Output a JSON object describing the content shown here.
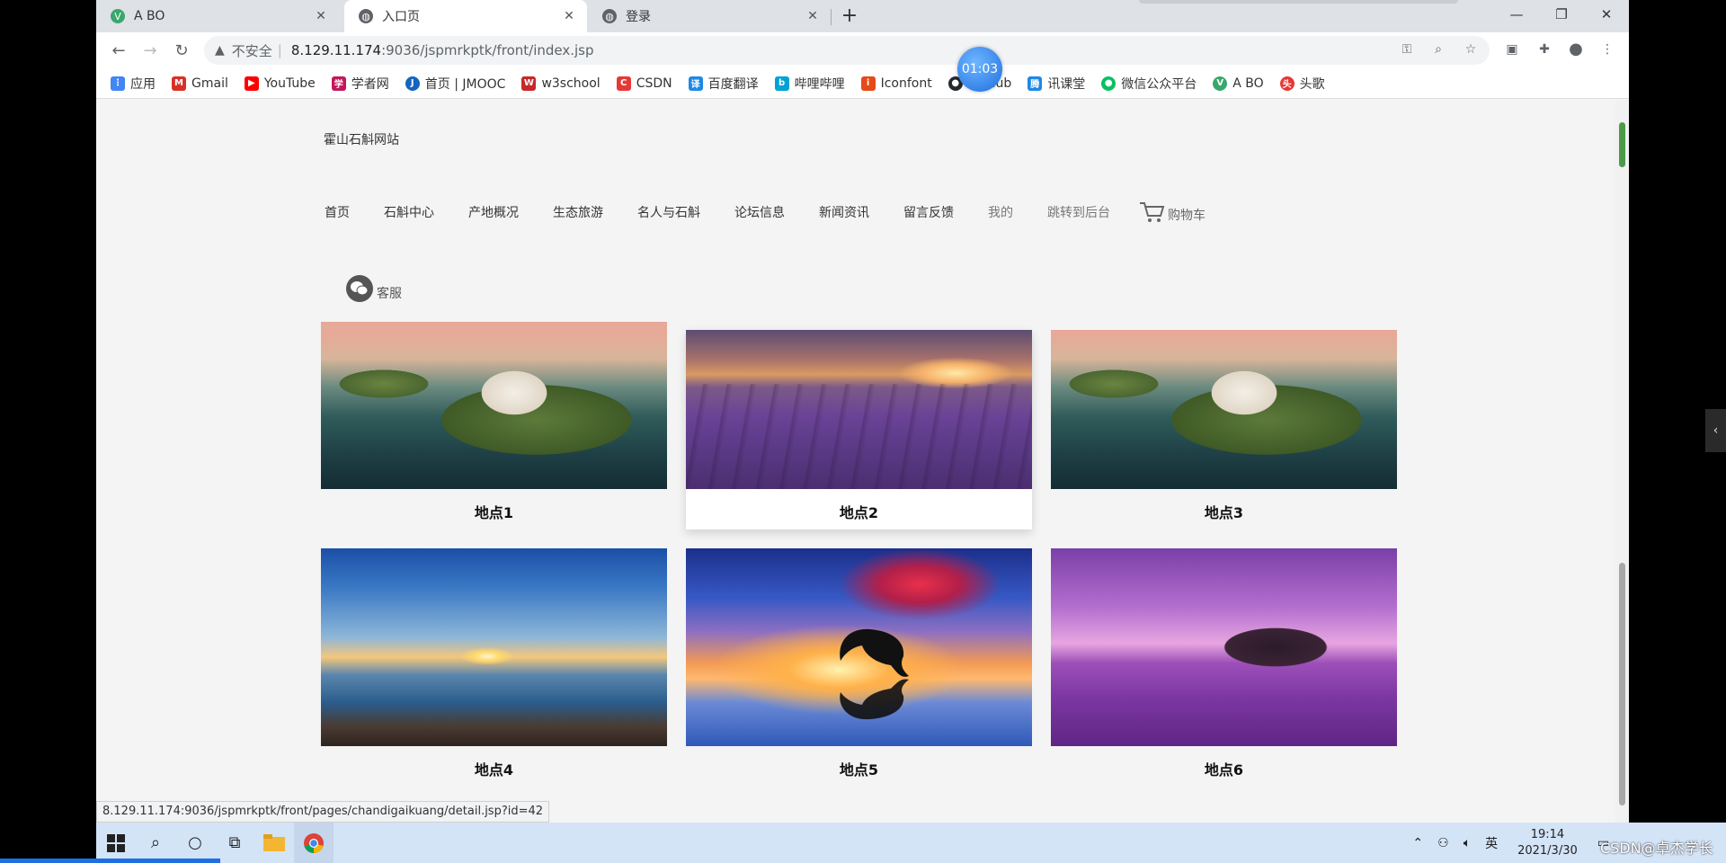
{
  "tabs": [
    {
      "title": "A BO",
      "favicon_color": "#3aa76d"
    },
    {
      "title": "入口页",
      "favicon_color": "#5f6368"
    },
    {
      "title": "登录",
      "favicon_color": "#5f6368"
    }
  ],
  "toolbar": {
    "security": "不安全",
    "url_host": "8.129.11.174",
    "url_path": ":9036/jspmrkptk/front/index.jsp"
  },
  "timer": "01:03",
  "bookmarks": [
    {
      "label": "应用",
      "icon": "apps-icon",
      "color": "#4285f4"
    },
    {
      "label": "Gmail",
      "icon": "gmail-icon",
      "color": "#d93025"
    },
    {
      "label": "YouTube",
      "icon": "youtube-icon",
      "color": "#ff0000"
    },
    {
      "label": "学者网",
      "icon": "scholar-icon",
      "color": "#c2185b"
    },
    {
      "label": "首页 | JMOOC",
      "icon": "jmooc-icon",
      "color": "#1565c0"
    },
    {
      "label": "w3school",
      "icon": "w3school-icon",
      "color": "#c62828"
    },
    {
      "label": "CSDN",
      "icon": "csdn-icon",
      "color": "#e53935"
    },
    {
      "label": "百度翻译",
      "icon": "baidu-translate-icon",
      "color": "#1e88e5"
    },
    {
      "label": "哔哩哔哩",
      "icon": "bilibili-icon",
      "color": "#00a1d6"
    },
    {
      "label": "Iconfont",
      "icon": "iconfont-icon",
      "color": "#e64a19"
    },
    {
      "label": "GitHub",
      "icon": "github-icon",
      "color": "#24292e"
    },
    {
      "label": "讯课堂",
      "icon": "tencent-class-icon",
      "color": "#1e88e5"
    },
    {
      "label": "微信公众平台",
      "icon": "wechat-icon",
      "color": "#07c160"
    },
    {
      "label": "A BO",
      "icon": "abo-icon",
      "color": "#3aa76d"
    },
    {
      "label": "头歌",
      "icon": "touge-icon",
      "color": "#e53935"
    }
  ],
  "site": {
    "title": "霍山石斛网站",
    "nav": [
      "首页",
      "石斛中心",
      "产地概况",
      "生态旅游",
      "名人与石斛",
      "论坛信息",
      "新闻资讯",
      "留言反馈",
      "我的",
      "跳转到后台"
    ],
    "cart": "购物车",
    "service": "客服"
  },
  "cards": [
    {
      "caption": "地点1"
    },
    {
      "caption": "地点2"
    },
    {
      "caption": "地点3"
    },
    {
      "caption": "地点4"
    },
    {
      "caption": "地点5"
    },
    {
      "caption": "地点6"
    }
  ],
  "status_url": "8.129.11.174:9036/jspmrkptk/front/pages/chandigaikuang/detail.jsp?id=42",
  "taskbar": {
    "ime": "英",
    "time": "19:14",
    "date": "2021/3/30"
  },
  "watermark": "CSDN@卓杰学长"
}
